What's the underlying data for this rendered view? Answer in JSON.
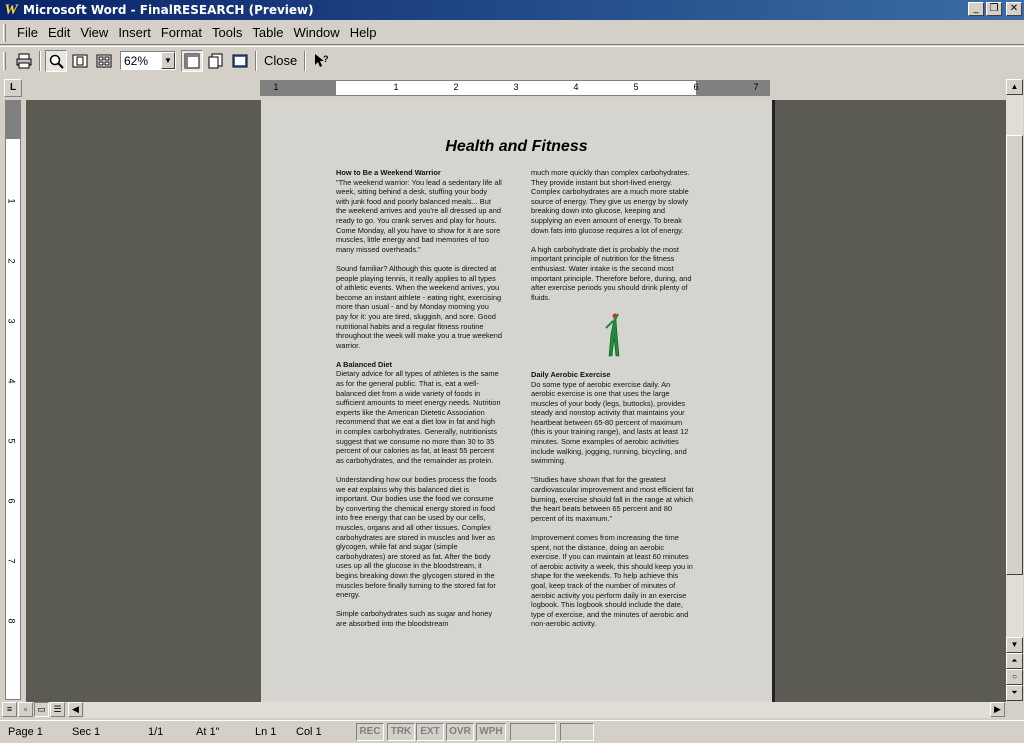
{
  "window": {
    "title": "Microsoft Word - FinalRESEARCH (Preview)",
    "controls": {
      "minimize": "_",
      "restore": "❐",
      "close": "✕"
    }
  },
  "menu": [
    "File",
    "Edit",
    "View",
    "Insert",
    "Format",
    "Tools",
    "Table",
    "Window",
    "Help"
  ],
  "toolbar": {
    "zoom_value": "62%",
    "close_label": "Close",
    "icons": [
      "print-icon",
      "magnifier-icon",
      "one-page-icon",
      "multiple-pages-icon",
      "view-ruler-icon",
      "shrink-to-fit-icon",
      "full-screen-icon",
      "context-help-icon"
    ]
  },
  "ruler": {
    "h_labels": [
      "1",
      "1",
      "2",
      "3",
      "4",
      "5",
      "6",
      "7"
    ],
    "v_labels": [
      "1",
      "2",
      "3",
      "4",
      "5",
      "6",
      "7",
      "8"
    ]
  },
  "document": {
    "title": "Health and Fitness",
    "left_column": [
      {
        "head": "How to Be a Weekend Warrior",
        "text": "\"The weekend warrior: You lead a sedentary life all week, sitting behind a desk, stuffing your body with junk food and poorly balanced meals... But the weekend arrives and you're all dressed up and ready to go. You crank serves and play for hours. Come Monday, all you have to show for it are sore muscles, little energy and bad memories of too many missed overheads.\""
      },
      {
        "head": "",
        "text": "Sound familiar? Although this quote is directed at people playing tennis, it really applies to all types of athletic events. When the weekend arrives, you become an instant athlete - eating right, exercising more than usual - and by Monday morning you pay for it: you are tired, sluggish, and sore. Good nutritional habits and a regular fitness routine throughout the week will make you a true weekend warrior."
      },
      {
        "head": "A Balanced Diet",
        "text": "Dietary advice for all types of athletes is the same as for the general public. That is, eat a well-balanced diet from a wide variety of foods in sufficient amounts to meet energy needs. Nutrition experts like the American Dietetic Association recommend that we eat a diet low in fat and high in complex carbohydrates. Generally, nutritionists suggest that we consume no more than 30 to 35 percent of our calories as fat, at least 55 percent as carbohydrates, and the remainder as protein."
      },
      {
        "head": "",
        "text": "Understanding how our bodies process the foods we eat explains why this balanced diet is important. Our bodies use the food we consume by converting the chemical energy stored in food into free energy that can be used by our cells, muscles, organs and all other tissues. Complex carbohydrates are stored in muscles and liver as glycogen, while fat and sugar (simple carbohydrates) are stored as fat. After the body uses up all the glucose in the bloodstream, it begins breaking down the glycogen stored in the muscles before finally turning to the stored fat for energy."
      },
      {
        "head": "",
        "text": "Simple carbohydrates such as sugar and honey are absorbed into the bloodstream"
      }
    ],
    "right_column_top": [
      {
        "head": "",
        "text": "much more quickly than complex carbohydrates. They provide instant but short-lived energy. Complex carbohydrates are a much more stable source of energy. They give us energy by slowly breaking down into glucose, keeping and supplying an even amount of energy. To break down fats into glucose requires a lot of energy."
      },
      {
        "head": "",
        "text": "A high carbohydrate diet is probably the most important principle of nutrition for the fitness enthusiast. Water intake is the second most important principle. Therefore before, during, and after exercise periods you should drink plenty of fluids."
      }
    ],
    "right_column_bottom": [
      {
        "head": "Daily Aerobic Exercise",
        "text": "Do some type of aerobic exercise daily. An aerobic exercise is one that uses the large muscles of your body (legs, buttocks), provides steady and nonstop activity that maintains your heartbeat between 65-80 percent of maximum (this is your training range), and lasts at least 12 minutes. Some examples of aerobic activities include walking, jogging, running, bicycling, and swimming."
      },
      {
        "head": "",
        "text": "\"Studies have shown that for the greatest cardiovascular improvement and most efficient fat burning, exercise should fall in the range at which the heart beats between 65 percent and 80 percent of its maximum.\""
      },
      {
        "head": "",
        "text": "Improvement comes from increasing the time spent, not the distance, doing an aerobic exercise. If you can maintain at least 60 minutes of aerobic activity a week, this should keep you in shape for the weekends. To help achieve this goal, keep track of the number of minutes of aerobic activity you perform daily in an exercise logbook. This logbook should include the date, type of exercise, and the minutes of aerobic and non-aerobic activity."
      }
    ]
  },
  "status": {
    "page": "Page 1",
    "sec": "Sec 1",
    "pages": "1/1",
    "at": "At 1\"",
    "ln": "Ln 1",
    "col": "Col 1",
    "rec": "REC",
    "trk": "TRK",
    "ext": "EXT",
    "ovr": "OVR",
    "wph": "WPH"
  }
}
